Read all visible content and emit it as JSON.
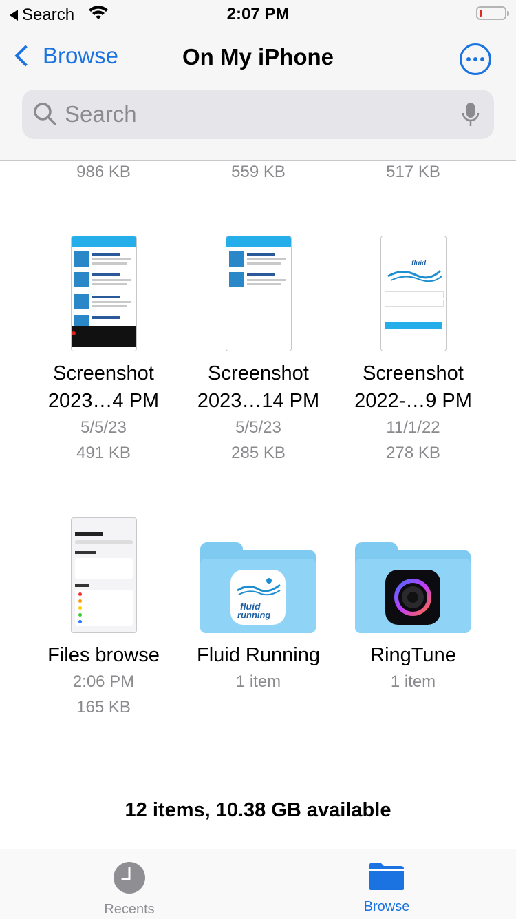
{
  "status_bar": {
    "back_app": "Search",
    "time": "2:07 PM"
  },
  "nav": {
    "back_label": "Browse",
    "title": "On My iPhone"
  },
  "search": {
    "placeholder": "Search"
  },
  "top_sizes": [
    "986 KB",
    "559 KB",
    "517 KB"
  ],
  "files": [
    {
      "name1": "Screenshot",
      "name2": "2023…4 PM",
      "date": "5/5/23",
      "size": "491 KB"
    },
    {
      "name1": "Screenshot",
      "name2": "2023…14 PM",
      "date": "5/5/23",
      "size": "285 KB"
    },
    {
      "name1": "Screenshot",
      "name2": "2022-…9 PM",
      "date": "11/1/22",
      "size": "278 KB"
    },
    {
      "name1": "Files browse",
      "date": "2:06 PM",
      "size": "165 KB"
    }
  ],
  "folders": [
    {
      "name": "Fluid Running",
      "count": "1 item"
    },
    {
      "name": "RingTune",
      "count": "1 item"
    }
  ],
  "footer": "12 items, 10.38 GB available",
  "tabs": [
    {
      "label": "Recents",
      "color": "#8e8e93"
    },
    {
      "label": "Browse",
      "color": "#1a73e0"
    }
  ],
  "colors": {
    "accent": "#1a73e0",
    "folder": "#8fd4f6"
  }
}
